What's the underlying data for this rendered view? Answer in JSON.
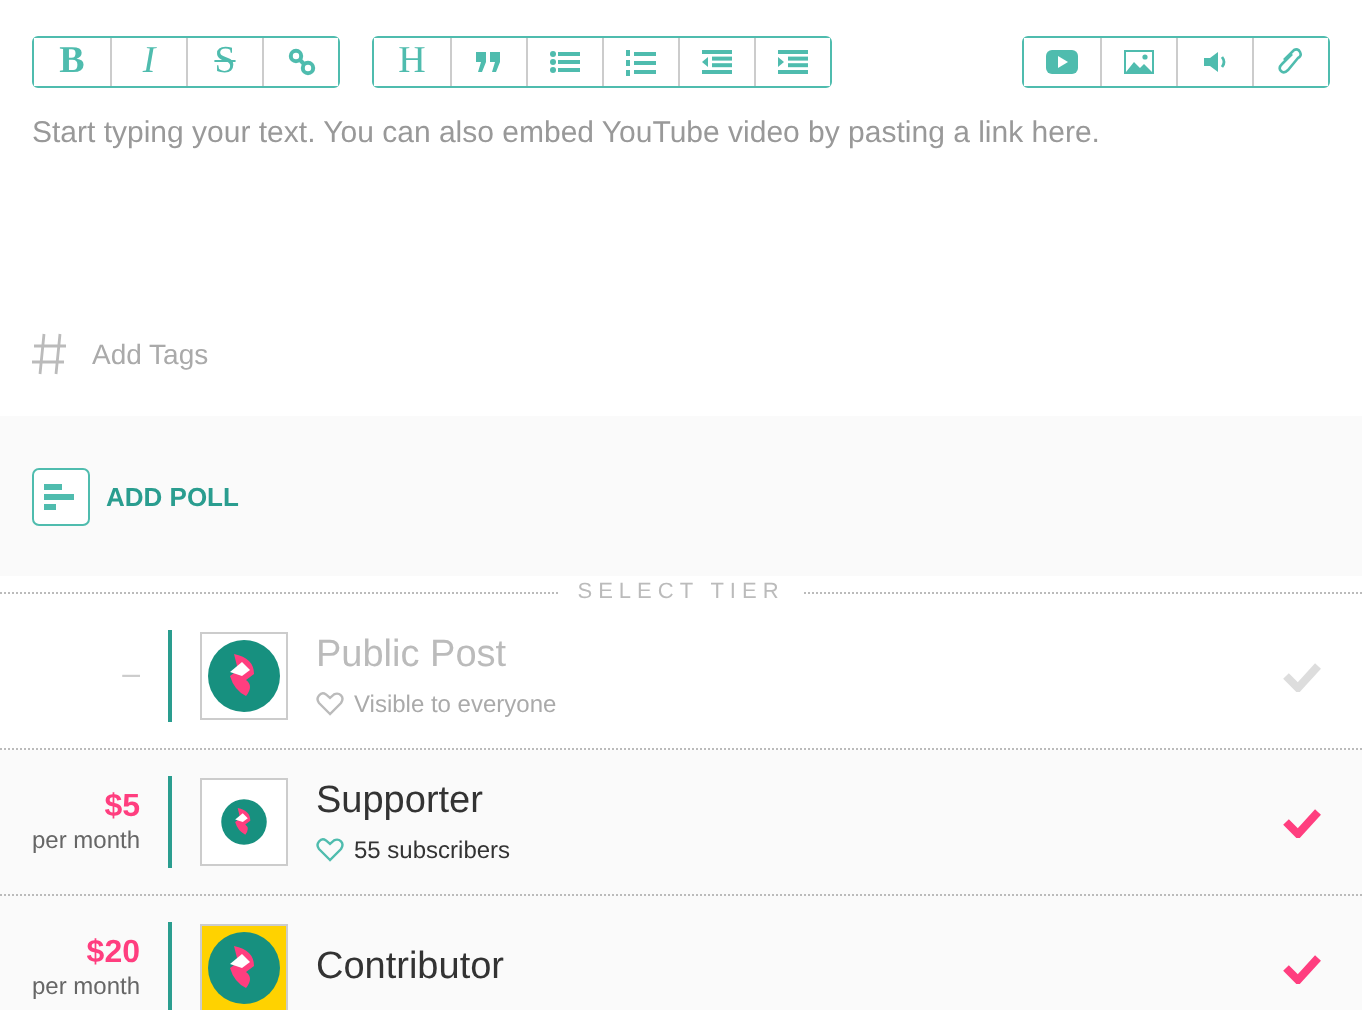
{
  "toolbar": {
    "groups": [
      {
        "buttons": [
          {
            "kind": "bold",
            "label": "B"
          },
          {
            "kind": "italic",
            "label": "I"
          },
          {
            "kind": "strike",
            "label": "S"
          },
          {
            "kind": "link"
          }
        ]
      },
      {
        "buttons": [
          {
            "kind": "heading",
            "label": "H"
          },
          {
            "kind": "quote"
          },
          {
            "kind": "bullets"
          },
          {
            "kind": "numbers"
          },
          {
            "kind": "outdent"
          },
          {
            "kind": "indent"
          }
        ]
      },
      {
        "buttons": [
          {
            "kind": "video"
          },
          {
            "kind": "image"
          },
          {
            "kind": "audio"
          },
          {
            "kind": "attach"
          }
        ]
      }
    ]
  },
  "editor": {
    "placeholder": "Start typing your text. You can also embed YouTube video by pasting a link here."
  },
  "tags": {
    "placeholder": "Add Tags"
  },
  "poll": {
    "label": "ADD POLL"
  },
  "tier_heading": "SELECT TIER",
  "tiers": [
    {
      "price": "–",
      "name": "Public Post",
      "info": "Visible to everyone",
      "selected": false,
      "color": "#ffffff"
    },
    {
      "price": "$5",
      "period": "per month",
      "name": "Supporter",
      "info": "55 subscribers",
      "selected": true,
      "color": "#ffffff"
    },
    {
      "price": "$20",
      "period": "per month",
      "name": "Contributor",
      "selected": true,
      "color": "#ffd200"
    }
  ]
}
